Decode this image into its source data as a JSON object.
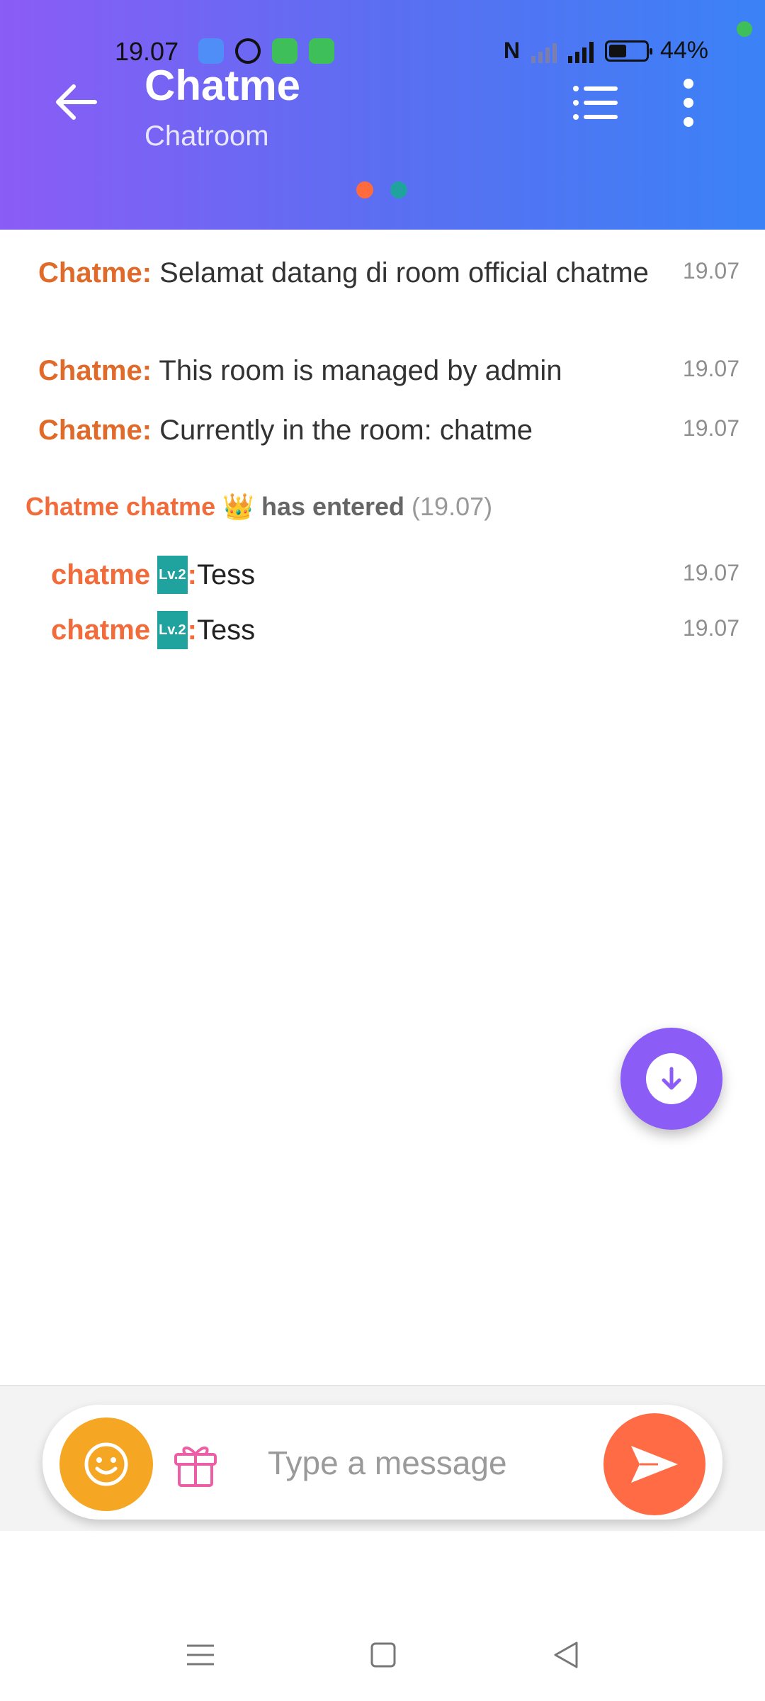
{
  "status_bar": {
    "time": "19.07",
    "battery": "44%",
    "nfc": "N"
  },
  "header": {
    "title": "Chatme",
    "subtitle": "Chatroom",
    "dot_colors": [
      "#ff6b3d",
      "#20a39e"
    ]
  },
  "messages": [
    {
      "sender": "Chatme:",
      "text": "Selamat datang di room official chatme",
      "time": "19.07"
    },
    {
      "sender": "Chatme:",
      "text": "This room is managed by admin",
      "time": "19.07"
    },
    {
      "sender": "Chatme:",
      "text": "Currently in the room: chatme",
      "time": "19.07"
    }
  ],
  "entered": {
    "name": "Chatme chatme",
    "emoji": "👑",
    "text": "has entered",
    "time": "(19.07)"
  },
  "chat": [
    {
      "name": "chatme",
      "level": "Lv.2",
      "colon": ":",
      "text": "Tess",
      "time": "19.07"
    },
    {
      "name": "chatme",
      "level": "Lv.2",
      "colon": ":",
      "text": "Tess",
      "time": "19.07"
    }
  ],
  "input": {
    "placeholder": "Type a message"
  },
  "colors": {
    "accent_purple": "#8b5cf6",
    "accent_orange": "#ff6b45",
    "emoji_yellow": "#f5a623",
    "name_orange": "#f26b3a"
  }
}
